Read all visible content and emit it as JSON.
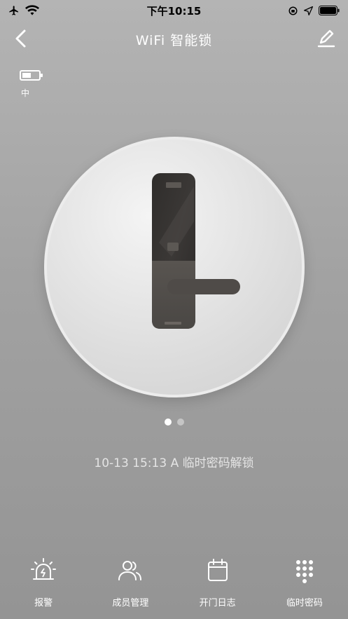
{
  "status_bar": {
    "time": "下午10:15",
    "airplane_icon": "airplane-icon",
    "wifi_icon": "wifi-signal-icon",
    "location_icon": "location-arrow-icon",
    "battery_icon": "battery-full-icon"
  },
  "nav": {
    "title": "WiFi 智能锁",
    "back_icon": "chevron-left-icon",
    "edit_icon": "pencil-edit-icon"
  },
  "lock_battery": {
    "icon": "battery-medium-icon",
    "label": "中"
  },
  "carousel": {
    "active_index": 0,
    "count": 2
  },
  "last_event": "10-13 15:13  A 临时密码解锁",
  "tabs": [
    {
      "label": "报警",
      "icon": "alarm-siren-icon"
    },
    {
      "label": "成员管理",
      "icon": "members-icon"
    },
    {
      "label": "开门日志",
      "icon": "calendar-log-icon"
    },
    {
      "label": "临时密码",
      "icon": "keypad-icon"
    }
  ],
  "colors": {
    "background_top": "#b4b4b4",
    "background_bottom": "#949494",
    "lock_body": "#3a3836",
    "accent": "#ffffff"
  }
}
